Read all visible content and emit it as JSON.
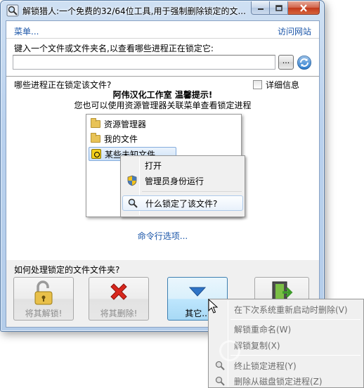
{
  "window": {
    "title": "解锁猎人:一个免费的32/64位工具,用于强制删除锁定的文..."
  },
  "top": {
    "menu_link": "菜单...",
    "visit_link": "访问网站",
    "prompt": "键入一个文件或文件夹名,以查看哪些进程正在锁定它:",
    "path_value": "",
    "browse_label": "..."
  },
  "processes": {
    "label": "哪些进程正在锁定该文件?",
    "detail_label": "详细信息",
    "detail_checked": false
  },
  "notice": {
    "title": "阿伟汉化工作室 温馨提示!",
    "subtitle": "您也可以使用资源管理器关联菜单查看锁定进程"
  },
  "illustration": {
    "items": [
      "资源管理器",
      "我的文件",
      "某些未知文件"
    ],
    "context_menu": {
      "open": "打开",
      "run_as_admin": "管理员身份运行",
      "what_locked": "什么锁定了该文件?"
    }
  },
  "cmd_link": "命令行选项...",
  "actions": {
    "label": "如何处理锁定的文件文件夹?",
    "unlock": "将其解锁!",
    "delete": "将其删除!",
    "other": "其它..."
  },
  "dropdown": {
    "items": [
      {
        "label": "在下次系统重新启动时删除(V)",
        "icon": "none"
      },
      {
        "label": "解锁重命名(W)",
        "icon": "none"
      },
      {
        "label": "解锁复制(X)",
        "icon": "none"
      },
      {
        "label": "终止锁定进程(Y)",
        "icon": "process-kill-icon"
      },
      {
        "label": "删除从磁盘锁定进程(Z)",
        "icon": "process-delete-icon"
      }
    ]
  },
  "colors": {
    "link": "#1a55a8",
    "disabled_text": "#8c8c8c",
    "hover_button": "#bee6fd"
  }
}
